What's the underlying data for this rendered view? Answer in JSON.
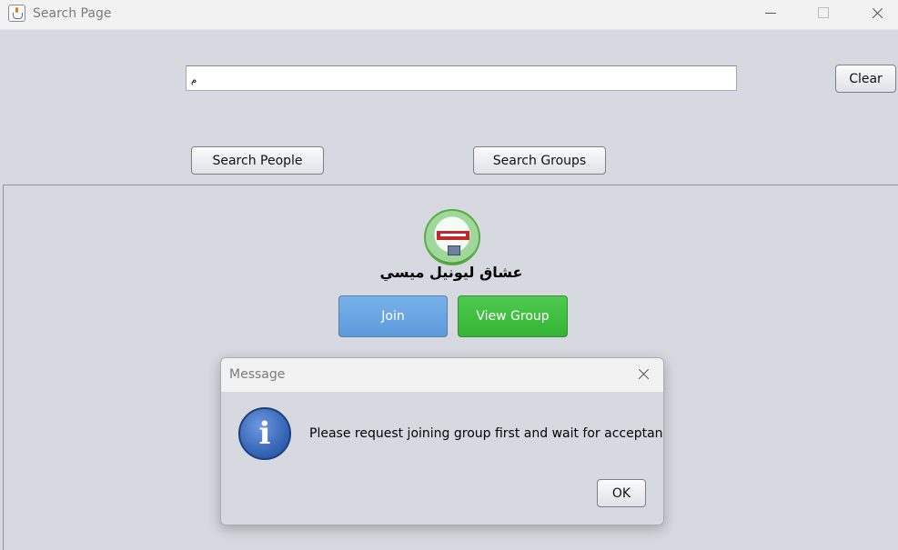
{
  "window": {
    "title": "Search Page",
    "app_icon": "java-cup-icon"
  },
  "search": {
    "value": "م",
    "clear_label": "Clear"
  },
  "actions": {
    "search_people_label": "Search People",
    "search_groups_label": "Search Groups"
  },
  "result": {
    "group_name": "عشاق ليونيل ميسي",
    "join_label": "Join",
    "view_group_label": "View Group",
    "join_color": "#5d9adb",
    "view_color": "#34b334"
  },
  "dialog": {
    "title": "Message",
    "icon": "info-icon",
    "message": "Please request joining group first and wait for acceptance",
    "ok_label": "OK"
  }
}
